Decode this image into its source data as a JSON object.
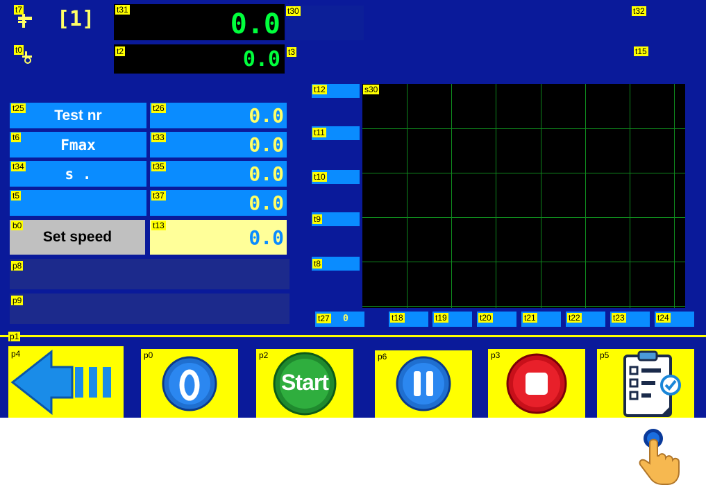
{
  "header": {
    "channel_label": "[1]",
    "tag_t7": "t7",
    "tag_t0": "t0",
    "tag_t31": "t31",
    "tag_t2": "t2",
    "tag_t30": "t30",
    "tag_t3": "t3",
    "tag_t32": "t32",
    "tag_t15": "t15",
    "force_value": "0.0",
    "position_value": "0.0",
    "plug_icon": "plug-icon",
    "stretch_icon": "stretch-icon"
  },
  "rows": [
    {
      "label_tag": "t25",
      "label": "Test nr",
      "value_tag": "t26",
      "value": "0.0"
    },
    {
      "label_tag": "t6",
      "label": "Fmax",
      "value_tag": "t33",
      "value": "0.0"
    },
    {
      "label_tag": "t34",
      "label": "s .",
      "value_tag": "t35",
      "value": "0.0"
    },
    {
      "label_tag": "t5",
      "label": "",
      "value_tag": "t37",
      "value": "0.0"
    }
  ],
  "speed": {
    "button_tag": "b0",
    "button_label": "Set speed",
    "value_tag": "t13",
    "value": "0.0"
  },
  "messages": {
    "p8_tag": "p8",
    "p9_tag": "p9"
  },
  "chart_data": {
    "type": "line",
    "canvas_tag": "s30",
    "y_axis_tags": [
      "t12",
      "t11",
      "t10",
      "t9",
      "t8"
    ],
    "x_axis_tags": [
      "t27",
      "t18",
      "t19",
      "t20",
      "t21",
      "t22",
      "t23",
      "t24"
    ],
    "x_origin_value": "0",
    "grid": true,
    "series": []
  },
  "toolbar": {
    "separator_tag": "p1",
    "buttons": [
      {
        "tag": "p4",
        "icon": "back-arrow-icon"
      },
      {
        "tag": "p0",
        "icon": "zero-icon",
        "text": "0"
      },
      {
        "tag": "p2",
        "icon": "start-icon",
        "text": "Start"
      },
      {
        "tag": "p6",
        "icon": "pause-icon"
      },
      {
        "tag": "p3",
        "icon": "stop-icon"
      },
      {
        "tag": "p5",
        "icon": "checklist-icon"
      }
    ]
  },
  "touch_hint_icon": "tap-hand-icon",
  "colors": {
    "panel": "#0a1a9a",
    "label_blue": "#0a8cff",
    "tag_yellow": "#ffff00",
    "digit_green": "#00ff3c",
    "grid_green": "#0f8a1e"
  }
}
